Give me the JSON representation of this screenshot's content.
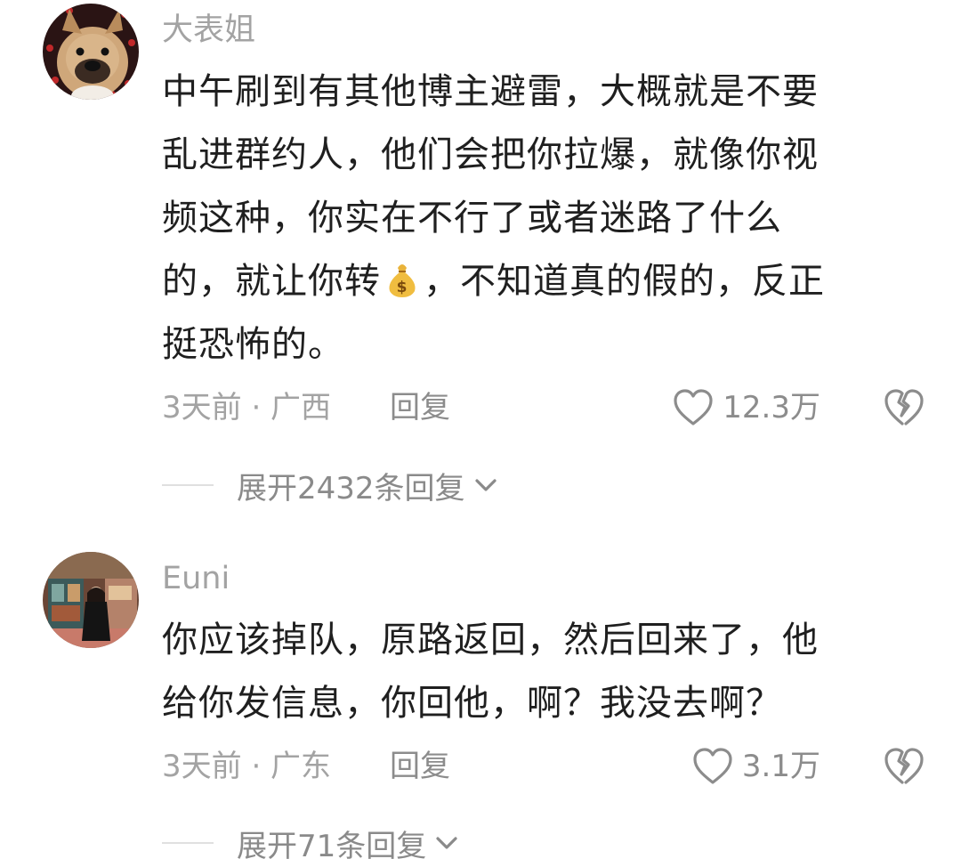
{
  "comments": [
    {
      "username": "大表姐",
      "avatar_icon": "french-bulldog-avatar",
      "lines": [
        "中午刷到有其他博主避雷，大概就是不要",
        "乱进群约人，他们会把你拉爆，就像你视",
        "频这种，你实在不行了或者迷路了什么"
      ],
      "line4_before": "的，就让你转",
      "line4_emoji": "money-bag-emoji",
      "line4_after": "，不知道真的假的，反正",
      "line5": "挺恐怖的。",
      "meta": "3天前 · 广西",
      "reply_label": "回复",
      "like_count": "12.3万",
      "expand_label": "展开2432条回复"
    },
    {
      "username": "Euni",
      "avatar_icon": "woman-in-shop-avatar",
      "lines": [
        "你应该掉队，原路返回，然后回来了，他",
        "给你发信息，你回他，啊？我没去啊？"
      ],
      "meta": "3天前 · 广东",
      "reply_label": "回复",
      "like_count": "3.1万",
      "expand_label": "展开71条回复"
    }
  ],
  "icons": {
    "like": "heart-outline-icon",
    "dislike": "broken-heart-icon",
    "expand": "chevron-down-icon"
  },
  "colors": {
    "text": "#1f1f1f",
    "meta": "#a3a3a3",
    "icon": "#8c8c8c"
  }
}
